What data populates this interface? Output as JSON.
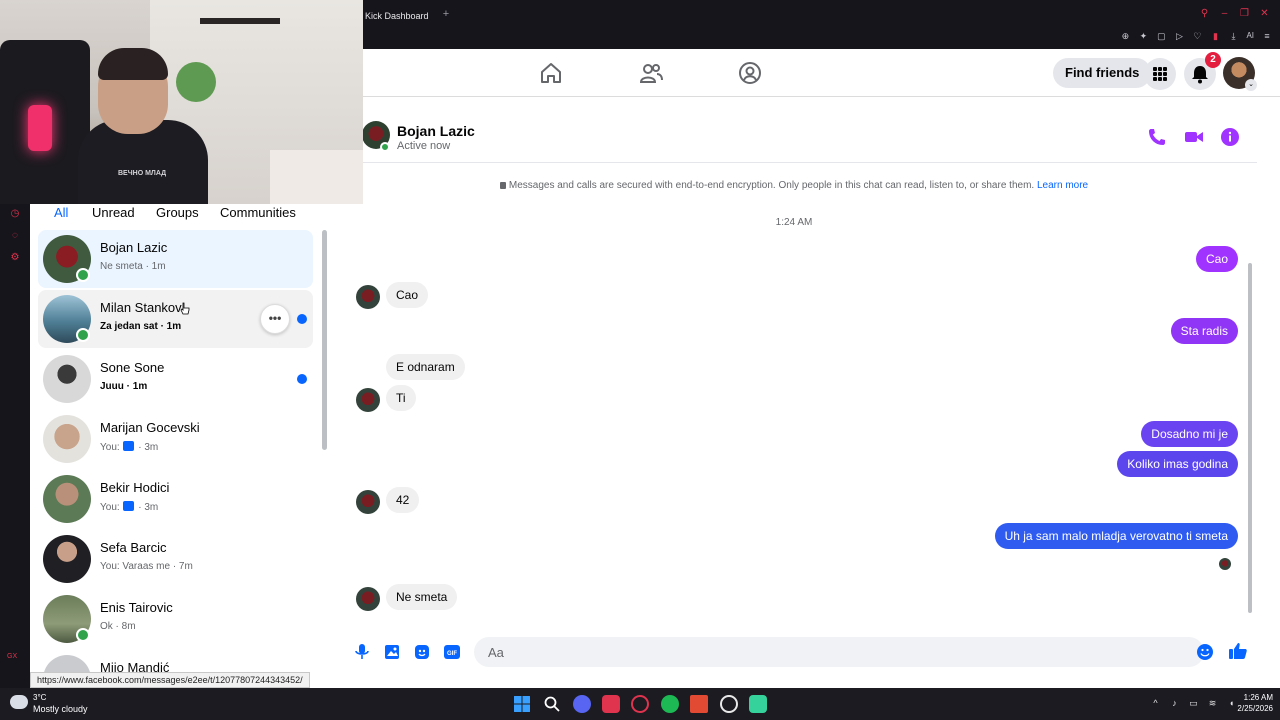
{
  "browser": {
    "tab_title": "Kick Dashboard",
    "new_tab_glyph": "+",
    "toolbar_ai_label": "AI",
    "status_url": "https://www.facebook.com/messages/e2ee/t/12077807244343452/"
  },
  "webcam": {
    "shirt_text": "ВЕЧНО МЛАД"
  },
  "facebook_header": {
    "find_friends_label": "Find friends",
    "notification_count": "2",
    "nav_icons": [
      "home-icon",
      "friends-icon",
      "groups-icon"
    ]
  },
  "chat_list": {
    "filters": [
      "All",
      "Unread",
      "Groups",
      "Communities"
    ],
    "chats": [
      {
        "name": "Bojan Lazic",
        "preview": "Ne smeta · 1m",
        "online": true,
        "unread": false,
        "selected": true
      },
      {
        "name": "Milan Stankov",
        "preview": "Za jedan sat · 1m",
        "online": true,
        "unread": true,
        "hover": true
      },
      {
        "name": "Sone Sone",
        "preview": "Juuu · 1m",
        "online": false,
        "unread": true
      },
      {
        "name": "Marijan Gocevski",
        "preview_prefix": "You:",
        "preview_suffix": "· 3m",
        "online": false,
        "unread": false
      },
      {
        "name": "Bekir Hodici",
        "preview_prefix": "You:",
        "preview_suffix": "· 3m",
        "online": false,
        "unread": false
      },
      {
        "name": "Sefa Barcic",
        "preview": "You: Varaas me · 7m",
        "online": false,
        "unread": false
      },
      {
        "name": "Enis Tairovic",
        "preview": "Ok · 8m",
        "online": true,
        "unread": false
      },
      {
        "name": "Mijo Mandić",
        "preview": "",
        "online": false,
        "unread": false
      }
    ],
    "more_glyph": "•••"
  },
  "conversation": {
    "contact_name": "Bojan Lazic",
    "contact_status": "Active now",
    "encryption_notice": "Messages and calls are secured with end-to-end encryption. Only people in this chat can read, listen to, or share them.",
    "learn_more": "Learn more",
    "timestamp": "1:24 AM",
    "messages": [
      {
        "from": "me",
        "text": "Cao"
      },
      {
        "from": "them",
        "text": "Cao"
      },
      {
        "from": "me",
        "text": "Sta radis"
      },
      {
        "from": "them",
        "text": "E odnaram"
      },
      {
        "from": "them",
        "text": "Ti"
      },
      {
        "from": "me",
        "text": "Dosadno mi je"
      },
      {
        "from": "me",
        "text": "Koliko imas godina"
      },
      {
        "from": "them",
        "text": "42"
      },
      {
        "from": "me",
        "text": "Uh ja sam malo mladja verovatno ti smeta"
      },
      {
        "from": "them",
        "text": "Ne smeta"
      }
    ],
    "composer_placeholder": "Aa"
  },
  "taskbar": {
    "temperature": "3°C",
    "weather": "Mostly cloudy",
    "time": "1:26 AM",
    "date": "2/25/2026"
  },
  "colors": {
    "accent_blue": "#0866ff",
    "messenger_purple": "#a033ff",
    "online_green": "#31a24c",
    "notification_red": "#e41e3f"
  }
}
